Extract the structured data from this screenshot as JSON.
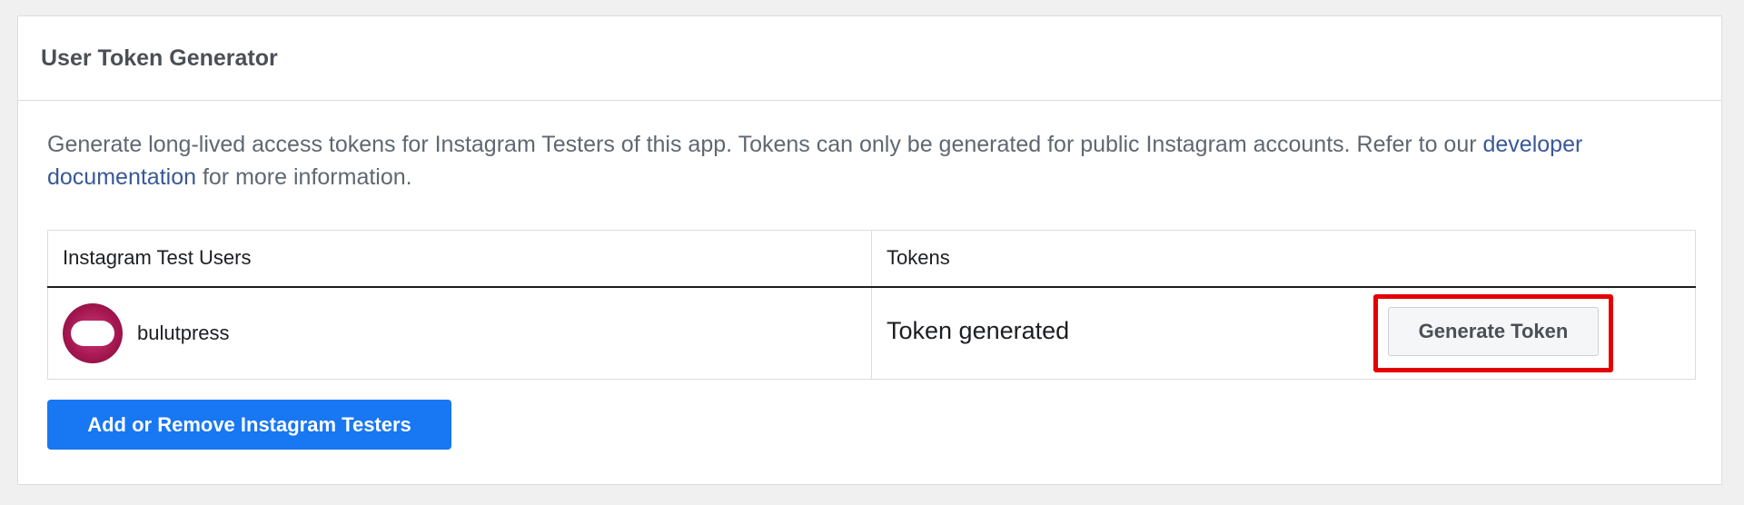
{
  "card": {
    "title": "User Token Generator"
  },
  "description": {
    "text_before": "Generate long-lived access tokens for Instagram Testers of this app. Tokens can only be generated for public Instagram accounts. Refer to our ",
    "link_text": "developer documentation",
    "text_after": " for more information."
  },
  "table": {
    "headers": [
      "Instagram Test Users",
      "Tokens"
    ],
    "rows": [
      {
        "user": "bulutpress",
        "token_status": "Token generated",
        "action_label": "Generate Token"
      }
    ]
  },
  "actions": {
    "add_remove_label": "Add or Remove Instagram Testers"
  },
  "colors": {
    "primary_button": "#1877f2",
    "link": "#385898",
    "highlight": "#e50000"
  }
}
